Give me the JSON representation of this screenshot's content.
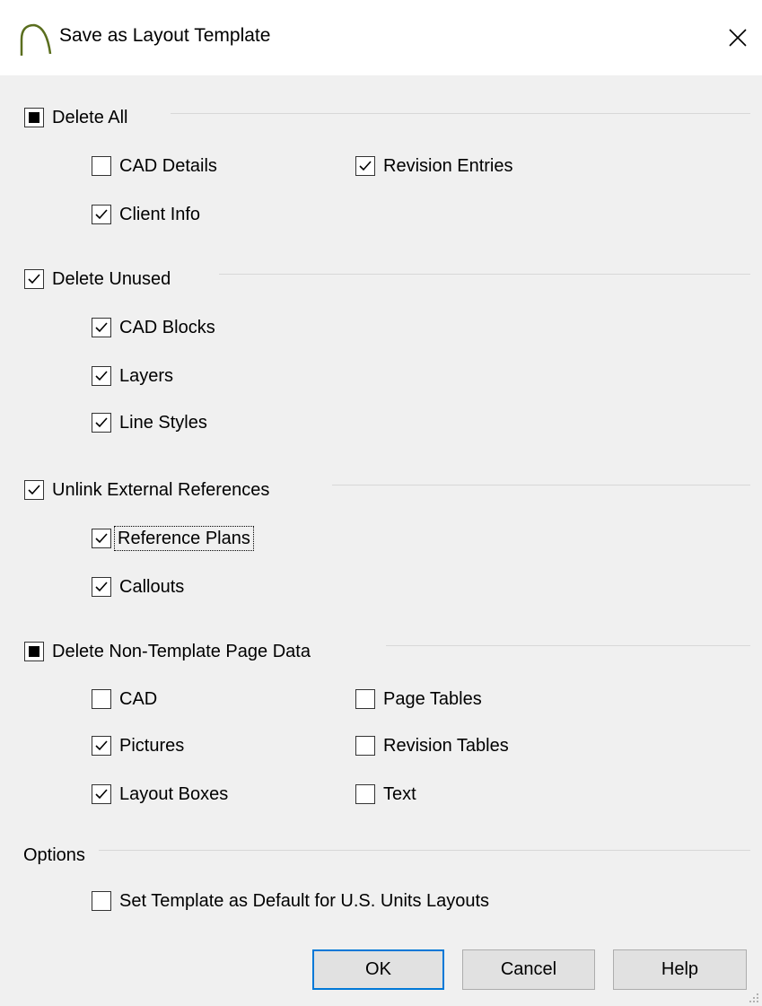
{
  "window": {
    "title": "Save as Layout Template",
    "app_icon": "arch-icon",
    "close_icon": "close-icon"
  },
  "groups": {
    "delete_all": {
      "label": "Delete All",
      "state": "indeterminate",
      "items": [
        {
          "label": "CAD Details",
          "checked": false
        },
        {
          "label": "Revision Entries",
          "checked": true
        },
        {
          "label": "Client Info",
          "checked": true
        }
      ]
    },
    "delete_unused": {
      "label": "Delete Unused",
      "state": "checked",
      "items": [
        {
          "label": "CAD Blocks",
          "checked": true
        },
        {
          "label": "Layers",
          "checked": true
        },
        {
          "label": "Line Styles",
          "checked": true
        }
      ]
    },
    "unlink_external": {
      "label": "Unlink External References",
      "state": "checked",
      "items": [
        {
          "label": "Reference Plans",
          "checked": true,
          "focused": true
        },
        {
          "label": "Callouts",
          "checked": true
        }
      ]
    },
    "delete_non_template": {
      "label": "Delete Non-Template Page Data",
      "state": "indeterminate",
      "items": [
        {
          "label": "CAD",
          "checked": false
        },
        {
          "label": "Page Tables",
          "checked": false
        },
        {
          "label": "Pictures",
          "checked": true
        },
        {
          "label": "Revision Tables",
          "checked": false
        },
        {
          "label": "Layout Boxes",
          "checked": true
        },
        {
          "label": "Text",
          "checked": false
        }
      ]
    },
    "options": {
      "label": "Options",
      "items": [
        {
          "label": "Set Template as Default for U.S. Units Layouts",
          "checked": false
        }
      ]
    }
  },
  "buttons": {
    "ok": "OK",
    "cancel": "Cancel",
    "help": "Help"
  },
  "colors": {
    "focus_accent": "#0078d7",
    "dialog_bg": "#f0f0f0",
    "titlebar_bg": "#ffffff"
  }
}
